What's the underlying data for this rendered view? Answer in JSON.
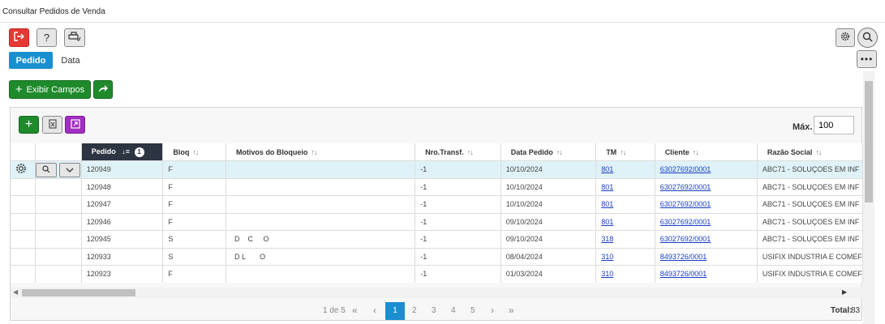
{
  "window": {
    "title": "Consultar Pedidos de Venda"
  },
  "toolbar": {
    "exit_icon": "exit-icon",
    "help_label": "?",
    "print_icon": "print-icon"
  },
  "tabs": [
    {
      "label": "Pedido",
      "active": true
    },
    {
      "label": "Data",
      "active": false
    }
  ],
  "actions": {
    "show_fields_label": "Exibir Campos",
    "plus_glyph": "+",
    "share_icon": "share-icon"
  },
  "grid_toolbar": {
    "max_label": "Máx.",
    "max_value": "100"
  },
  "grid": {
    "columns": [
      {
        "label": "Pedido",
        "sorted": true,
        "badge": "1"
      },
      {
        "label": "Bloq"
      },
      {
        "label": "Motivos do Bloqueio"
      },
      {
        "label": "Nro.Transf."
      },
      {
        "label": "Data Pedido"
      },
      {
        "label": "TM"
      },
      {
        "label": "Cliente"
      },
      {
        "label": "Razão Social"
      }
    ],
    "rows": [
      {
        "pedido": "120949",
        "bloq": "F",
        "motivos": "",
        "transf": "-1",
        "data": "10/10/2024",
        "tm": "801",
        "cliente": "63027692/0001",
        "razao": "ABC71 - SOLUÇOES EM INF"
      },
      {
        "pedido": "120948",
        "bloq": "F",
        "motivos": "",
        "transf": "-1",
        "data": "10/10/2024",
        "tm": "801",
        "cliente": "63027692/0001",
        "razao": "ABC71 - SOLUÇOES EM INF"
      },
      {
        "pedido": "120947",
        "bloq": "F",
        "motivos": "",
        "transf": "-1",
        "data": "10/10/2024",
        "tm": "801",
        "cliente": "63027692/0001",
        "razao": "ABC71 - SOLUÇOES EM INF"
      },
      {
        "pedido": "120946",
        "bloq": "F",
        "motivos": "",
        "transf": "-1",
        "data": "09/10/2024",
        "tm": "801",
        "cliente": "63027692/0001",
        "razao": "ABC71 - SOLUÇOES EM INF"
      },
      {
        "pedido": "120945",
        "bloq": "S",
        "motivos": "D    C     O",
        "transf": "-1",
        "data": "09/10/2024",
        "tm": "318",
        "cliente": "63027692/0001",
        "razao": "ABC71 - SOLUÇOES EM INF"
      },
      {
        "pedido": "120933",
        "bloq": "S",
        "motivos": "D L       O",
        "transf": "-1",
        "data": "08/04/2024",
        "tm": "310",
        "cliente": "8493726/0001",
        "razao": "USIFIX INDUSTRIA E COMEF"
      },
      {
        "pedido": "120923",
        "bloq": "F",
        "motivos": "",
        "transf": "-1",
        "data": "01/03/2024",
        "tm": "310",
        "cliente": "8493726/0001",
        "razao": "USIFIX INDUSTRIA E COMEF"
      }
    ]
  },
  "pager": {
    "summary": "1 de 5",
    "first": "«",
    "prev": "‹",
    "pages": [
      "1",
      "2",
      "3",
      "4",
      "5"
    ],
    "next": "›",
    "last": "»",
    "total_label": "Total:",
    "total_value": "83"
  },
  "colors": {
    "accent": "#1a8fd0",
    "danger": "#e53935",
    "success": "#1f8a2c",
    "purple": "#a12ec1",
    "header_dark": "#2d3442",
    "selected_row": "#dff2f8"
  }
}
